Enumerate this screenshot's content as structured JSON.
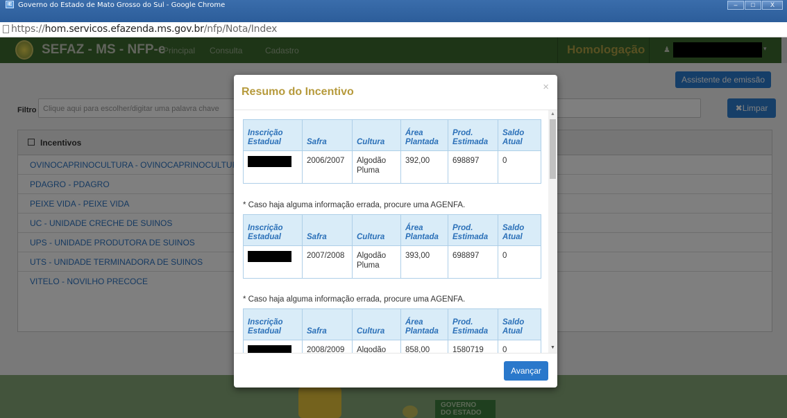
{
  "window": {
    "title": "Governo do Estado de Mato Grosso do Sul - Google Chrome",
    "url_prefix": "https://",
    "url_host": "hom.servicos.efazenda.ms.gov.br",
    "url_path": "/nfp/Nota/Index",
    "buttons": [
      "–",
      "□",
      "X"
    ]
  },
  "navbar": {
    "brand": "SEFAZ - MS - NFP-e",
    "links": [
      "Principal",
      "Consulta",
      "Cadastro"
    ],
    "environment": "Homologação"
  },
  "page": {
    "assist_button": "Assistente de emissão",
    "filter_label": "Filtro",
    "filter_placeholder": "Clique aqui para escolher/digitar uma palavra chave",
    "clear_button": "Limpar",
    "panel_title": "Incentivos",
    "items": [
      "OVINOCAPRINOCULTURA - OVINOCAPRINOCULTUR",
      "PDAGRO - PDAGRO",
      "PEIXE VIDA - PEIXE VIDA",
      "UC - UNIDADE CRECHE DE SUINOS",
      "UPS - UNIDADE PRODUTORA DE SUINOS",
      "UTS - UNIDADE TERMINADORA DE SUINOS",
      "VITELO - NOVILHO PRECOCE"
    ],
    "footer_gov": [
      "GOVERNO",
      "DO ESTADO"
    ]
  },
  "modal": {
    "title": "Resumo do Incentivo",
    "close": "×",
    "headers": [
      "Inscrição Estadual",
      "Safra",
      "Cultura",
      "Área Plantada",
      "Prod. Estimada",
      "Saldo Atual"
    ],
    "note": "* Caso haja alguma informação errada, procure uma AGENFA.",
    "rows": [
      {
        "safra": "2006/2007",
        "cultura": "Algodão Pluma",
        "area": "392,00",
        "prod": "698897",
        "saldo": "0"
      },
      {
        "safra": "2007/2008",
        "cultura": "Algodão Pluma",
        "area": "393,00",
        "prod": "698897",
        "saldo": "0"
      },
      {
        "safra": "2008/2009",
        "cultura": "Algodão",
        "area": "858,00",
        "prod": "1580719",
        "saldo": "0"
      }
    ],
    "next_button": "Avançar"
  }
}
